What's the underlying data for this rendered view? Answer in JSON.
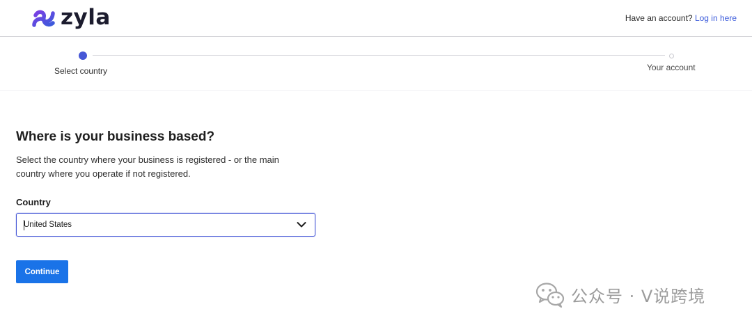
{
  "brand": {
    "name": "zyla"
  },
  "header": {
    "account_prompt": "Have an account?",
    "login_link": "Log in here"
  },
  "stepper": {
    "steps": [
      {
        "label": "Select country",
        "active": true
      },
      {
        "label": "Your account",
        "active": false
      }
    ]
  },
  "form": {
    "title": "Where is your business based?",
    "subtitle": "Select the country where your business is registered - or the main country where you operate if not registered.",
    "country_label": "Country",
    "country_value": "United States",
    "continue_label": "Continue"
  },
  "watermark": {
    "text": "公众号 · V说跨境"
  },
  "colors": {
    "accent": "#4657d6",
    "button": "#1a73e8",
    "link": "#3b5bdb"
  }
}
